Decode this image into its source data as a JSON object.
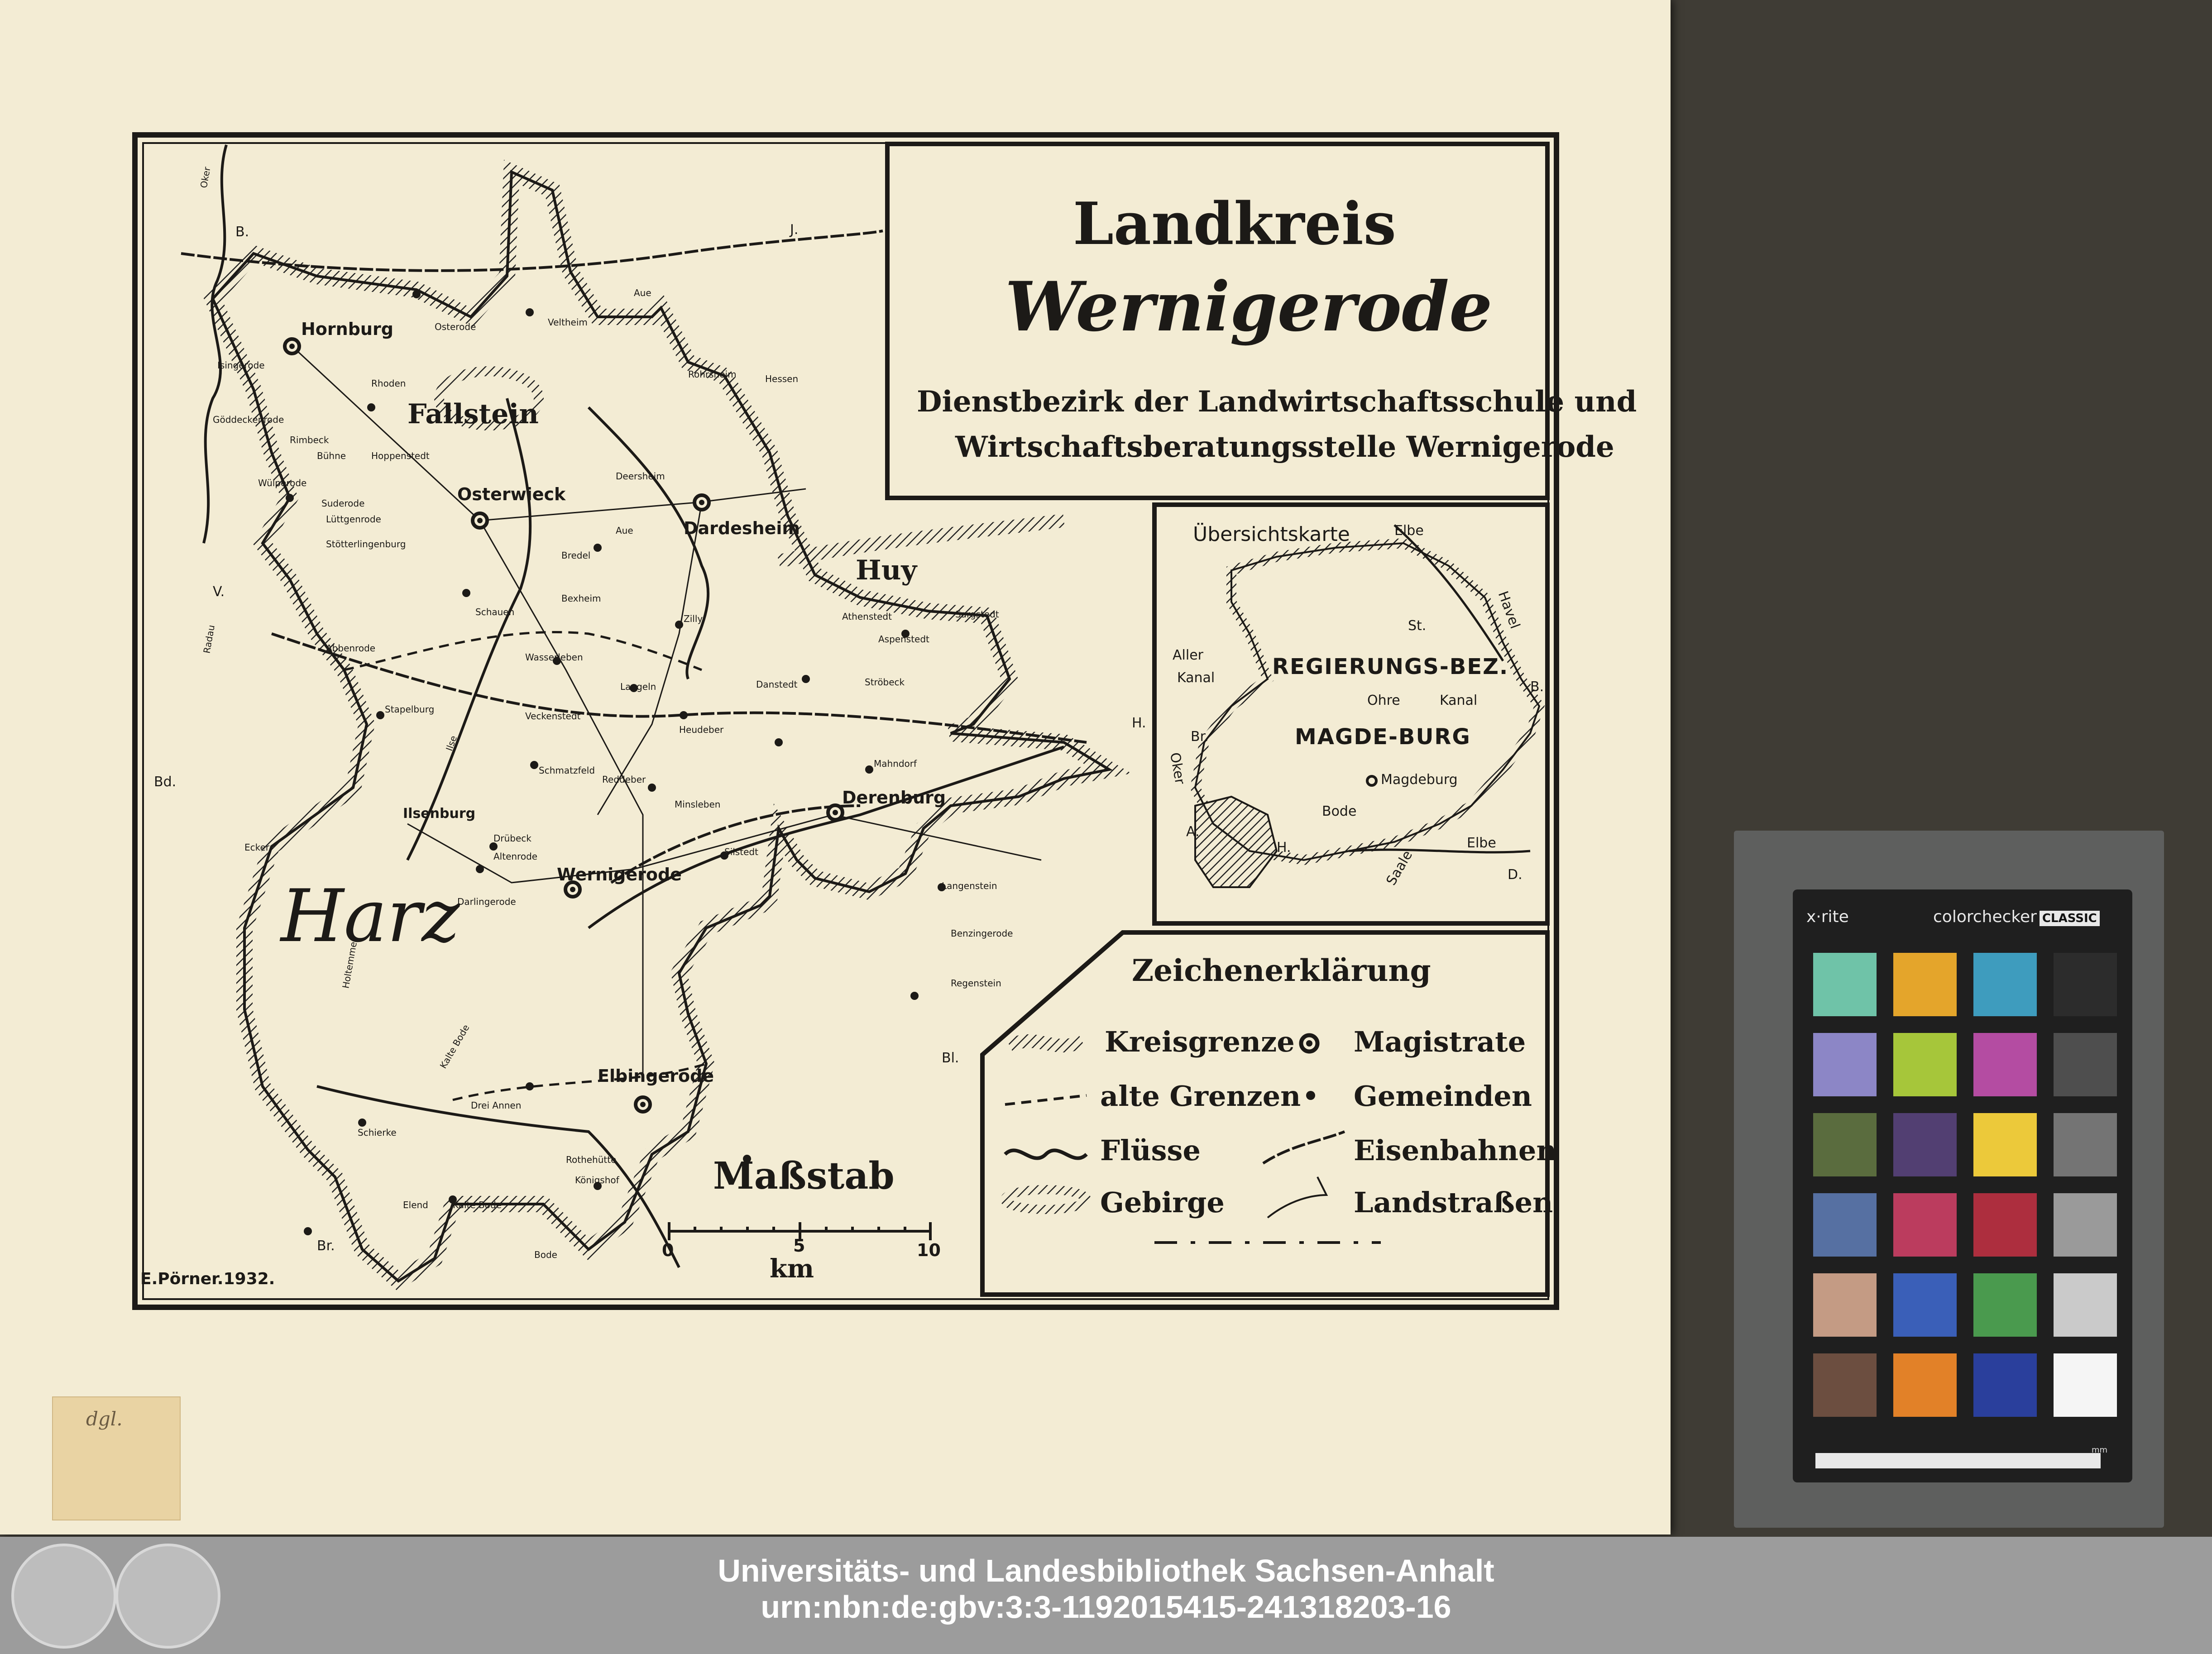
{
  "map": {
    "title_line1": "Landkreis",
    "title_line2": "Wernigerode",
    "subtitle_line1": "Dienstbezirk der Landwirtschaftsschule und",
    "subtitle_line2": "Wirtschaftsberatungsstelle Wernigerode",
    "author": "E.Pörner.1932.",
    "towns": [
      "Hornburg",
      "Osterwieck",
      "Dardesheim",
      "Derenburg",
      "Wernigerode",
      "Elbingerode",
      "Ilsenburg"
    ],
    "places": [
      "Osterode",
      "Veltheim",
      "Rhoden",
      "Isingerode",
      "Göddeckenrode",
      "Rimbeck",
      "Bühne",
      "Hoppenstedt",
      "Wülperode",
      "Suderode",
      "Lüttgenrode",
      "Stötterlingenburg",
      "Deersheim",
      "Aue",
      "Rohrsheim",
      "Hessen",
      "Bexheim",
      "Bredel",
      "Schauen",
      "Abbenrode",
      "Wasserleben",
      "Zilly",
      "Langeln",
      "Danstedt",
      "Ströbeck",
      "Athenstedt",
      "Aspenstedt",
      "Sargstedt",
      "Stapelburg",
      "Veckenstedt",
      "Heudeber",
      "Mahndorf",
      "Schmatzfeld",
      "Reddeber",
      "Minsleben",
      "Silstedt",
      "Drübeck",
      "Altenrode",
      "Darlingerode",
      "Langenstein",
      "Regenstein",
      "Drei Annen",
      "Schierke",
      "Rothehütte",
      "Königshof",
      "Elend",
      "Kalte Bode",
      "Benzingerode"
    ],
    "regions": [
      "Fallstein",
      "Huy",
      "Harz"
    ],
    "rivers": [
      "Oker",
      "Ilse",
      "Aue",
      "Ecker",
      "Radau",
      "Holtemme",
      "Bode",
      "Kalte Bode"
    ],
    "border_letters": [
      "B.",
      "J.",
      "V.",
      "Bd.",
      "H.",
      "Br.",
      "Bl."
    ]
  },
  "inset": {
    "title": "Übersichtskarte",
    "region_line1": "REGIERUNGS-BEZ.",
    "region_line2": "MAGDE-BURG",
    "city": "Magdeburg",
    "labels": [
      "Elbe",
      "Havel",
      "Aller",
      "Kanal",
      "Kanal",
      "Ohre",
      "Oker",
      "Bode",
      "Saale",
      "Elbe",
      "St.",
      "B.",
      "Br.",
      "H.",
      "D.",
      "A."
    ]
  },
  "legend": {
    "title": "Zeichenerklärung",
    "items": [
      {
        "label": "Kreisgrenze",
        "symbol": "hatched-border"
      },
      {
        "label": "alte Grenzen",
        "symbol": "dashed-line"
      },
      {
        "label": "Flüsse",
        "symbol": "wavy-line"
      },
      {
        "label": "Gebirge",
        "symbol": "hachures"
      },
      {
        "label": "Magistrate",
        "symbol": "circle-dot"
      },
      {
        "label": "Gemeinden",
        "symbol": "dot"
      },
      {
        "label": "Eisenbahnen",
        "symbol": "railway"
      },
      {
        "label": "Landstraßen",
        "symbol": "road"
      }
    ]
  },
  "scale": {
    "title": "Maßstab",
    "ticks": [
      "0",
      "5",
      "10"
    ],
    "unit": "km"
  },
  "stamp_text": "dgl.",
  "colorchecker": {
    "brand": "x·rite",
    "product": "colorchecker",
    "edition": "CLASSIC",
    "unit": "mm",
    "swatches": [
      "#6fc3a8",
      "#e4a52b",
      "#3e9cbe",
      "#2c2c2c",
      "#8c86c6",
      "#a6c63a",
      "#b44ca2",
      "#4e4e4e",
      "#5a6c3e",
      "#523f72",
      "#ecc93a",
      "#747474",
      "#5670a2",
      "#bb3c5e",
      "#ad2e3e",
      "#9a9a9a",
      "#c49b84",
      "#3a5fb8",
      "#4a9a4e",
      "#cacaca",
      "#6c4e40",
      "#e28128",
      "#2a3f9c",
      "#f5f5f5"
    ]
  },
  "footer": {
    "line1": "Universitäts- und Landesbibliothek Sachsen-Anhalt",
    "line2": "urn:nbn:de:gbv:3:3-1192015415-241318203-16",
    "background": "#9c9c9c"
  }
}
